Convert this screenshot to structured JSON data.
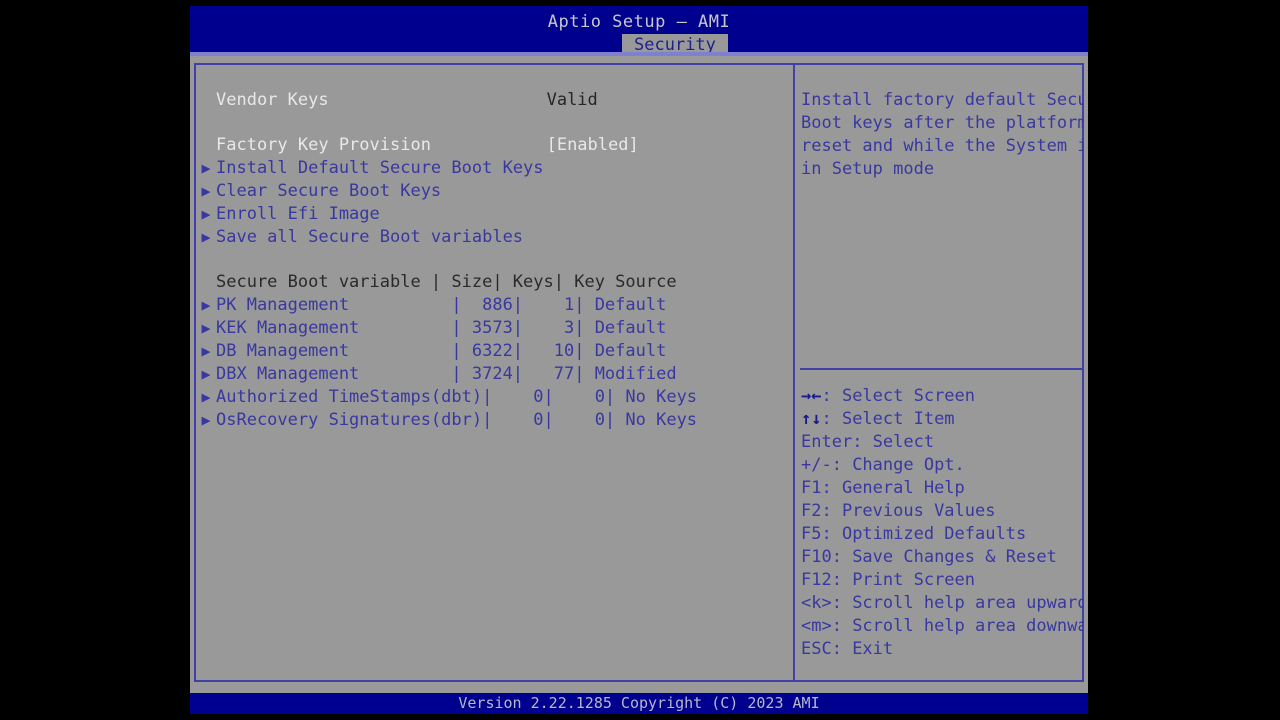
{
  "window": {
    "title": "Aptio Setup – AMI",
    "active_tab": "Security",
    "tabs": [
      "Security"
    ]
  },
  "colors": {
    "titlebar_blue": "#00008f",
    "panel_gray": "#999999",
    "border_blue": "#4040a8",
    "text_blue": "#3838a0",
    "text_white": "#e8e8e8",
    "tab_text": "#20208c"
  },
  "settings": {
    "status_rows": [
      {
        "label": "Vendor Keys",
        "value": "Valid",
        "label_color": "white",
        "value_color": "dark",
        "bullet": false
      }
    ],
    "option_rows": [
      {
        "label": "Factory Key Provision",
        "value": "[Enabled]",
        "label_color": "white",
        "value_color": "white",
        "bullet": false
      },
      {
        "label": "Install Default Secure Boot Keys",
        "value": "",
        "label_color": "blue",
        "value_color": "blue",
        "bullet": true
      },
      {
        "label": "Clear Secure Boot Keys",
        "value": "",
        "label_color": "blue",
        "value_color": "blue",
        "bullet": true
      },
      {
        "label": "Enroll Efi Image",
        "value": "",
        "label_color": "blue",
        "value_color": "blue",
        "bullet": true
      },
      {
        "label": "Save all Secure Boot variables",
        "value": "",
        "label_color": "blue",
        "value_color": "blue",
        "bullet": true
      }
    ]
  },
  "secure_boot_table": {
    "header": "Secure Boot variable | Size| Keys| Key Source",
    "columns": [
      "Secure Boot variable",
      "Size",
      "Keys",
      "Key Source"
    ],
    "rows": [
      {
        "text": "PK Management          |  886|    1| Default",
        "variable": "PK Management",
        "size": "886",
        "keys": "1",
        "key_source": "Default"
      },
      {
        "text": "KEK Management         | 3573|    3| Default",
        "variable": "KEK Management",
        "size": "3573",
        "keys": "3",
        "key_source": "Default"
      },
      {
        "text": "DB Management          | 6322|   10| Default",
        "variable": "DB Management",
        "size": "6322",
        "keys": "10",
        "key_source": "Default"
      },
      {
        "text": "DBX Management         | 3724|   77| Modified",
        "variable": "DBX Management",
        "size": "3724",
        "keys": "77",
        "key_source": "Modified"
      },
      {
        "text": "Authorized TimeStamps(dbt)|    0|    0| No Keys",
        "variable": "Authorized TimeStamps(dbt)",
        "size": "0",
        "keys": "0",
        "key_source": "No Keys"
      },
      {
        "text": "OsRecovery Signatures(dbr)|    0|    0| No Keys",
        "variable": "OsRecovery Signatures(dbr)",
        "size": "0",
        "keys": "0",
        "key_source": "No Keys"
      }
    ]
  },
  "help": {
    "description_lines": [
      "Install factory default Secure",
      "Boot keys after the platform",
      "reset and while the System is",
      "in Setup mode"
    ],
    "shortcuts": [
      {
        "glyph": "→←",
        "key": "",
        "text": ": Select Screen"
      },
      {
        "glyph": "↑↓",
        "key": "",
        "text": ": Select Item"
      },
      {
        "glyph": "",
        "key": "Enter",
        "text": ": Select"
      },
      {
        "glyph": "",
        "key": "+/-",
        "text": ": Change Opt."
      },
      {
        "glyph": "",
        "key": "F1",
        "text": ": General Help"
      },
      {
        "glyph": "",
        "key": "F2",
        "text": ": Previous Values"
      },
      {
        "glyph": "",
        "key": "F5",
        "text": ": Optimized Defaults"
      },
      {
        "glyph": "",
        "key": "F10",
        "text": ": Save Changes & Reset"
      },
      {
        "glyph": "",
        "key": "F12",
        "text": ": Print Screen"
      },
      {
        "glyph": "",
        "key": "<k>",
        "text": ": Scroll help area upwards"
      },
      {
        "glyph": "",
        "key": "<m>",
        "text": ": Scroll help area downwards"
      },
      {
        "glyph": "",
        "key": "ESC",
        "text": ": Exit"
      }
    ]
  },
  "footer": {
    "version_text": "Version 2.22.1285 Copyright (C) 2023 AMI"
  },
  "icons": {
    "submenu_arrow": "▶"
  }
}
